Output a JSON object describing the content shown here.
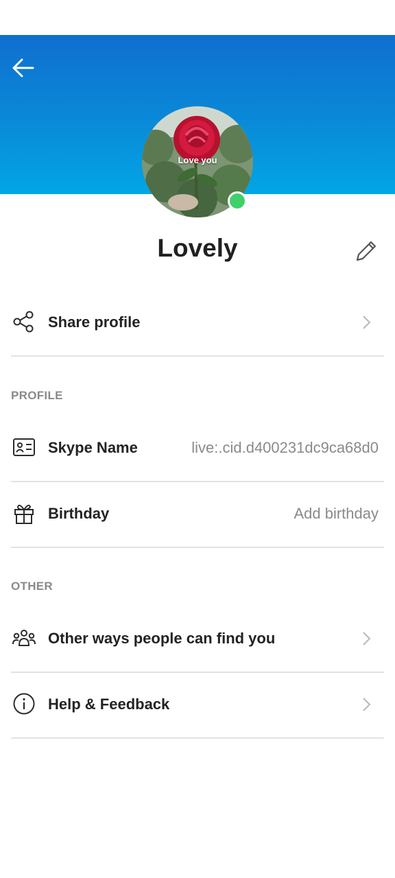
{
  "header": {
    "back_icon": "arrow-left-icon"
  },
  "profile": {
    "name": "Lovely",
    "avatar_caption": "Love you",
    "presence": "online",
    "presence_color": "#3fd06b",
    "edit_icon": "pencil-icon"
  },
  "share": {
    "label": "Share profile",
    "icon": "share-icon"
  },
  "sections": {
    "profile_header": "PROFILE",
    "other_header": "OTHER"
  },
  "profile_rows": [
    {
      "label": "Skype Name",
      "value": "live:.cid.d400231dc9ca68d0",
      "icon": "id-card-icon"
    },
    {
      "label": "Birthday",
      "value": "Add birthday",
      "icon": "gift-icon"
    }
  ],
  "other_rows": [
    {
      "label": "Other ways people can find you",
      "icon": "people-icon"
    },
    {
      "label": "Help & Feedback",
      "icon": "info-icon"
    }
  ],
  "colors": {
    "header_top": "#0f6fcf",
    "header_bottom": "#02a6e6"
  }
}
